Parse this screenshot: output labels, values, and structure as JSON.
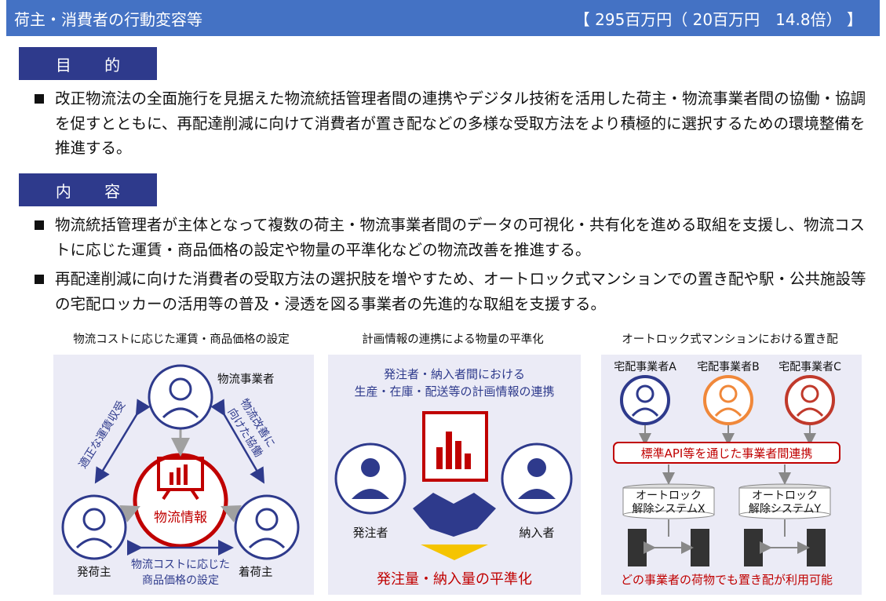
{
  "header": {
    "title": "荷主・消費者の行動変容等",
    "budget": "【 295百万円（ 20百万円　14.8倍） 】"
  },
  "sections": {
    "purpose_label": "目 的",
    "content_label": "内 容"
  },
  "purpose_bullets": [
    "改正物流法の全面施行を見据えた物流統括管理者間の連携やデジタル技術を活用した荷主・物流事業者間の協働・協調を促すとともに、再配達削減に向けて消費者が置き配などの多様な受取方法をより積極的に選択するための環境整備を推進する。"
  ],
  "content_bullets": [
    "物流統括管理者が主体となって複数の荷主・物流事業者間のデータの可視化・共有化を進める取組を支援し、物流コストに応じた運賃・商品価格の設定や物量の平準化などの物流改善を推進する。",
    "再配達削減に向けた消費者の受取方法の選択肢を増やすため、オートロック式マンションでの置き配や駅・公共施設等の宅配ロッカーの活用等の普及・浸透を図る事業者の先進的な取組を支援する。"
  ],
  "figure1": {
    "title": "物流コストに応じた運賃・商品価格の設定",
    "top_label": "物流事業者",
    "left_label": "発荷主",
    "right_label": "着荷主",
    "center_label": "物流情報",
    "left_arrow_label": "適正な運賃収受",
    "right_arrow_label_1": "物流改善に",
    "right_arrow_label_2": "向けた協働",
    "bottom_label_1": "物流コストに応じた",
    "bottom_label_2": "商品価格の設定"
  },
  "figure2": {
    "title": "計画情報の連携による物量の平準化",
    "desc_1": "発注者・納入者間における",
    "desc_2": "生産・在庫・配送等の計画情報の連携",
    "left_label": "発注者",
    "right_label": "納入者",
    "result": "発注量・納入量の平準化"
  },
  "figure3": {
    "title": "オートロック式マンションにおける置き配",
    "carriers": [
      "宅配事業者A",
      "宅配事業者B",
      "宅配事業者C"
    ],
    "carrier_colors": [
      "#2e3a8c",
      "#f0883a",
      "#c0392b"
    ],
    "link_label": "標準API等を通じた事業者間連携",
    "system_x_1": "オートロック",
    "system_x_2": "解除システムX",
    "system_y_1": "オートロック",
    "system_y_2": "解除システムY",
    "result": "どの事業者の荷物でも置き配が利用可能"
  },
  "colors": {
    "header_bg": "#4472c4",
    "label_bg": "#2e3a8c",
    "navy": "#2e3a8c",
    "red": "#c00000",
    "panel_bg": "#ebebf6"
  }
}
